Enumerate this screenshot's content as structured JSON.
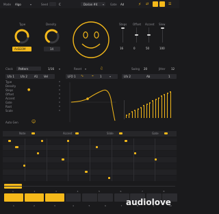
{
  "header": {
    "mode_label": "Mode",
    "mode_value": "Algo",
    "seed_label": "Seed",
    "seed_value": "C",
    "scale_value": "Dorian #4",
    "gate_label": "Gate",
    "gate_value": "Ad"
  },
  "knobs": [
    {
      "label": "Type",
      "value": "AsSEOM",
      "level": 0.8
    },
    {
      "label": "Density",
      "value": "14",
      "level": 0.65
    }
  ],
  "mods": {
    "headers": [
      "Steps",
      "Offset",
      "Accent",
      "Slew"
    ],
    "values": [
      "16",
      "0",
      "50",
      "100"
    ],
    "levels": [
      1.0,
      0.5,
      0.5,
      1.0
    ]
  },
  "transport": {
    "clock_label": "Clock",
    "clock_value": "Pattern",
    "div_value": "1/16",
    "reset_label": "Reset",
    "swing_label": "Swing",
    "swing_value": "20",
    "jitter_label": "Jitter",
    "jitter_value": "12"
  },
  "lfo": {
    "tabs": [
      "Lfo 1",
      "Lfo 2",
      "A1",
      "Vel"
    ],
    "params": [
      "Type",
      "Density",
      "Steps",
      "Offset",
      "Accent",
      "Gate",
      "Root",
      "Scale"
    ],
    "auto_gen": "Auto Gen",
    "lfo_label": "LFO 1",
    "lfo_rate": "1",
    "lfo2_label": "Lfo 2",
    "lfo2_mode": "Ab",
    "lfo2_value": "1"
  },
  "sequencer": {
    "lanes": [
      "Note",
      "Accent",
      "Slide",
      "Gate"
    ],
    "page_labels": [
      "1",
      "2",
      "3",
      "4",
      "5",
      "6",
      "7",
      "8"
    ],
    "pad_labels": [
      "1",
      "2",
      "3",
      "4",
      "5",
      "6",
      "7",
      "8",
      "9",
      "10"
    ]
  },
  "watermark": "audiolove",
  "colors": {
    "accent": "#f5b91a",
    "background": "#1a1a1c",
    "panel": "#242427"
  }
}
